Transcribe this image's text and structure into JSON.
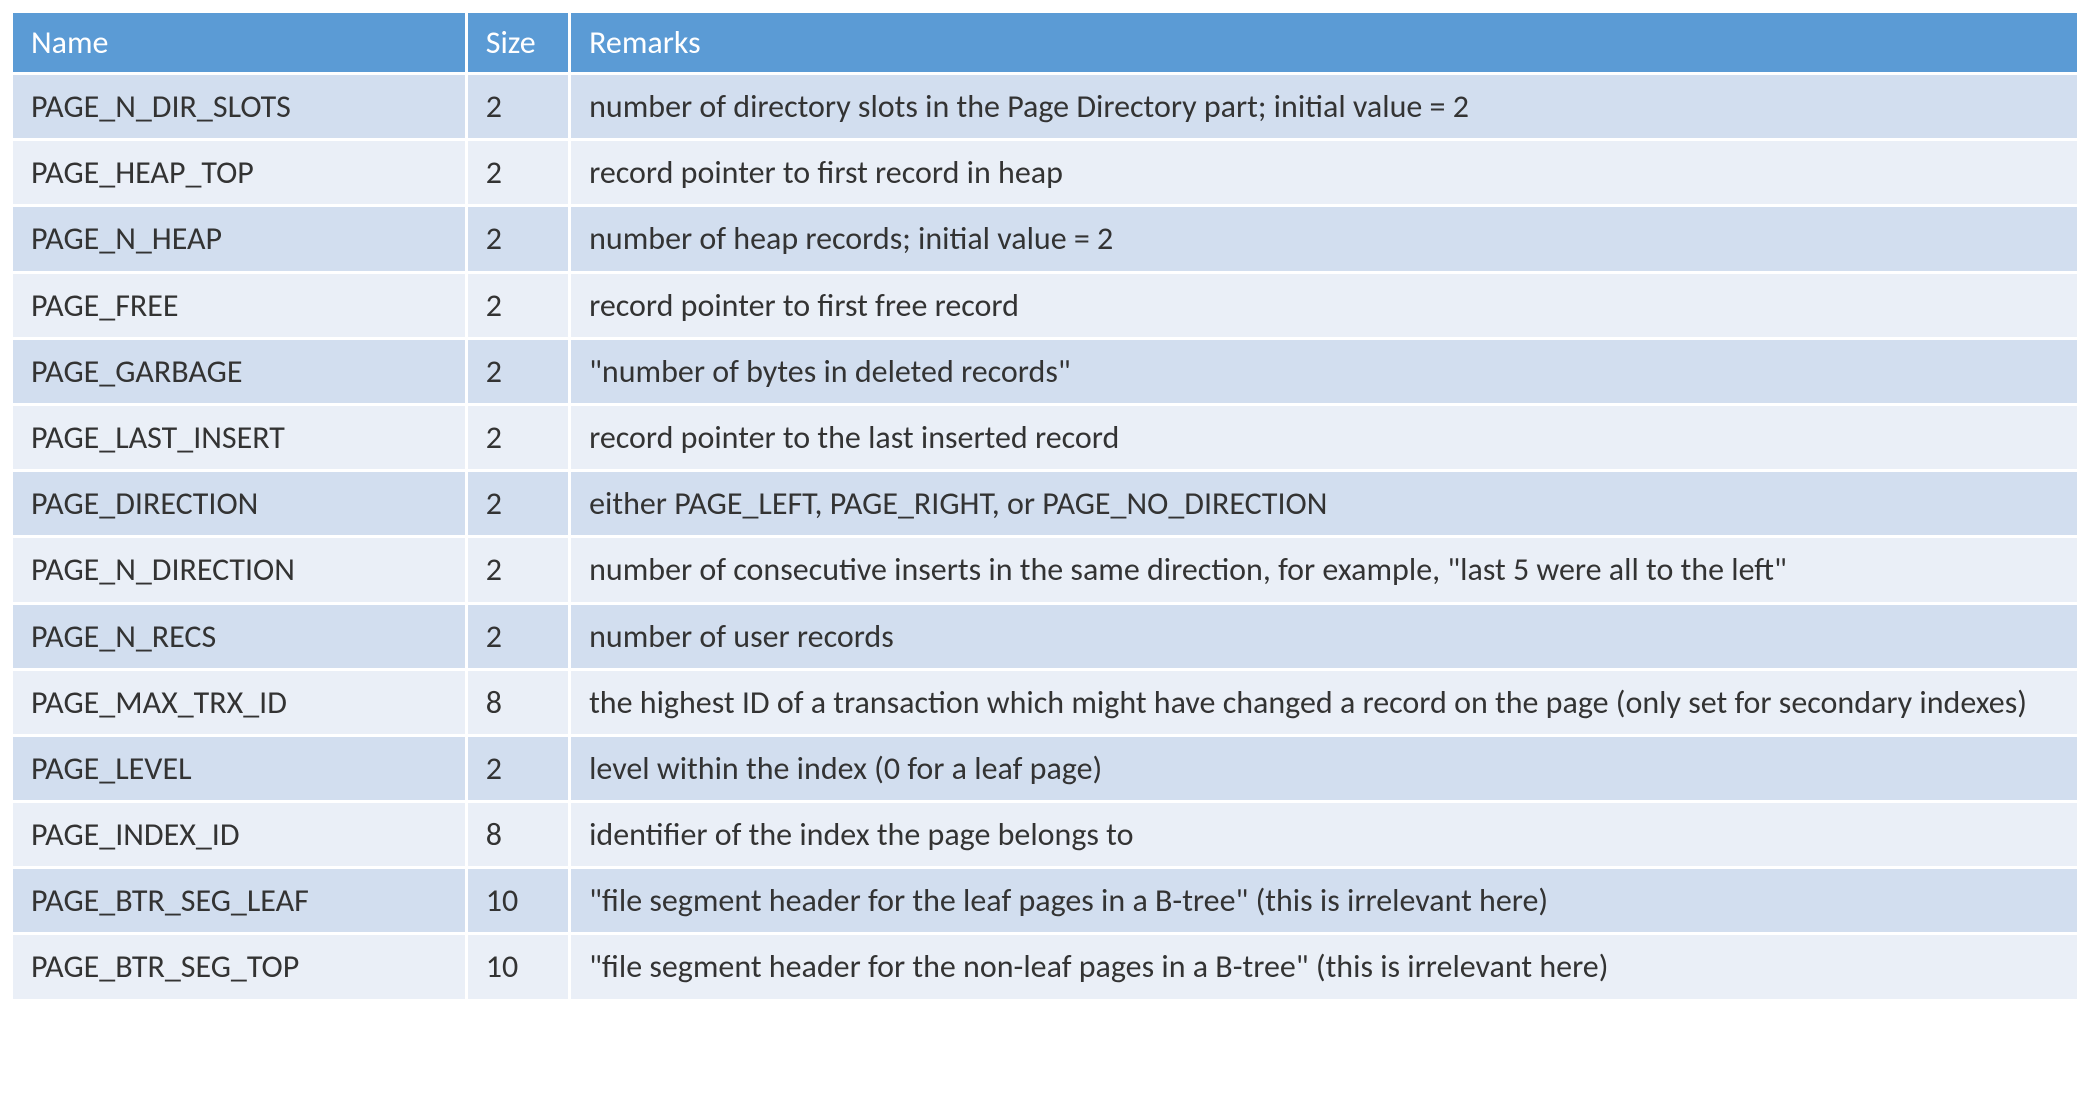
{
  "table": {
    "headers": {
      "name": "Name",
      "size": "Size",
      "remarks": "Remarks"
    },
    "rows": [
      {
        "name": "PAGE_N_DIR_SLOTS",
        "size": "2",
        "remarks": "number of directory slots in the Page Directory part; initial value = 2"
      },
      {
        "name": "PAGE_HEAP_TOP",
        "size": "2",
        "remarks": "record pointer to first record in heap"
      },
      {
        "name": "PAGE_N_HEAP",
        "size": "2",
        "remarks": "number of heap records; initial value = 2"
      },
      {
        "name": "PAGE_FREE",
        "size": "2",
        "remarks": "record pointer to first free record"
      },
      {
        "name": "PAGE_GARBAGE",
        "size": "2",
        "remarks": "\"number of bytes in deleted records\""
      },
      {
        "name": "PAGE_LAST_INSERT",
        "size": "2",
        "remarks": "record pointer to the last inserted record"
      },
      {
        "name": "PAGE_DIRECTION",
        "size": "2",
        "remarks": "either PAGE_LEFT, PAGE_RIGHT, or PAGE_NO_DIRECTION"
      },
      {
        "name": "PAGE_N_DIRECTION",
        "size": "2",
        "remarks": "number of consecutive inserts in the same direction, for example, \"last 5 were all to the left\""
      },
      {
        "name": "PAGE_N_RECS",
        "size": "2",
        "remarks": "number of user records"
      },
      {
        "name": "PAGE_MAX_TRX_ID",
        "size": "8",
        "remarks": "the highest ID of a transaction which might have changed a record on the page (only set for secondary indexes)"
      },
      {
        "name": "PAGE_LEVEL",
        "size": "2",
        "remarks": "level within the index (0 for a leaf page)"
      },
      {
        "name": "PAGE_INDEX_ID",
        "size": "8",
        "remarks": "identifier of the index the page belongs to"
      },
      {
        "name": "PAGE_BTR_SEG_LEAF",
        "size": "10",
        "remarks": "\"file segment header for the leaf pages in a B-tree\" (this is irrelevant here)"
      },
      {
        "name": "PAGE_BTR_SEG_TOP",
        "size": "10",
        "remarks": "\"file segment header for the non-leaf pages in a B-tree\" (this is irrelevant here)"
      }
    ]
  }
}
